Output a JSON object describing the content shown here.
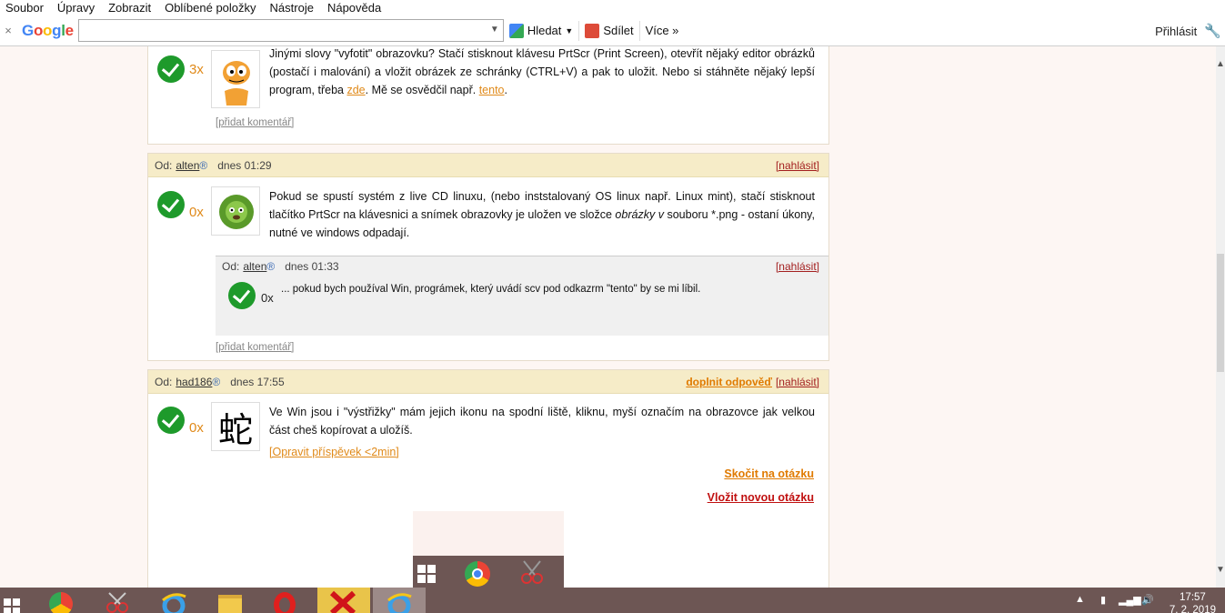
{
  "menu": [
    "Soubor",
    "Úpravy",
    "Zobrazit",
    "Oblíbené položky",
    "Nástroje",
    "Nápověda"
  ],
  "toolbar": {
    "close": "×",
    "logo_letters": [
      "G",
      "o",
      "o",
      "g",
      "l",
      "e"
    ],
    "search_value": "",
    "search_btn": "Hledat",
    "share_btn": "Sdílet",
    "more_btn": "Více »",
    "signin": "Přihlásit"
  },
  "post1": {
    "count": "3x",
    "text_a": "Jinými slovy \"vyfotit\" obrazovku? Stačí stisknout klávesu PrtScr (Print Screen), otevřít nějaký editor obrázků (postačí i malování) a vložit obrázek ze schránky (CTRL+V) a pak to uložit. Nebo si stáhněte nějaký lepší program, třeba ",
    "link1": "zde",
    "text_b": ". Mě se osvědčil např. ",
    "link2": "tento",
    "text_c": ".",
    "add_comment": "[přidat komentář]"
  },
  "post2": {
    "from": "Od:",
    "author": "alten",
    "reg": "®",
    "date": "dnes 01:29",
    "report": "[nahlásit]",
    "count": "0x",
    "text_a": "Pokud se spustí systém z live CD linuxu, (nebo inststalovaný OS linux např. Linux mint), stačí stisknout tlačítko PrtScr na klávesnici a snímek obrazovky je uložen ve složce ",
    "text_em": "obrázky v",
    "text_b": " souboru *.png - ostaní úkony, nutné ve windows odpadají.",
    "reply": {
      "from": "Od:",
      "author": "alten",
      "reg": "®",
      "date": "dnes 01:33",
      "report": "[nahlásit]",
      "count": "0x",
      "text": "... pokud bych používal Win, prográmek, který uvádí scv pod odkazrm \"tento\" by se mi líbil."
    },
    "add_comment": "[přidat komentář]"
  },
  "post3": {
    "from": "Od:",
    "author": "had186",
    "reg": "®",
    "date": "dnes 17:55",
    "complete": "doplnit odpověď",
    "report": "[nahlásit]",
    "count": "0x",
    "avatar_char": "蛇",
    "text": "Ve Win jsou i \"výstřižky\" mám jejich ikonu na spodní liště, kliknu, myší označím na obrazovce jak velkou část cheš kopírovat a uložíš.",
    "edit": "[Opravit příspěvek <2min]",
    "jump": "Skočit na otázku",
    "new_question": "Vložit novou otázku"
  },
  "taskbar": {
    "time": "17:57",
    "date": "7. 2. 2019"
  }
}
